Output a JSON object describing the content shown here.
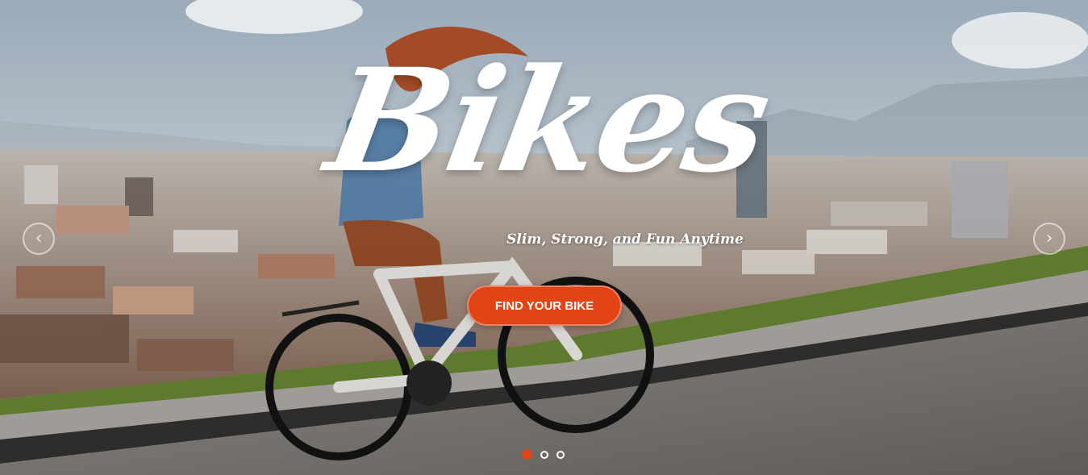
{
  "hero": {
    "title": "Bikes",
    "subtitle": "Slim, Strong, and Fun Anytime",
    "cta_label": "FIND YOUR BIKE"
  },
  "carousel": {
    "prev_icon": "chevron-left-icon",
    "next_icon": "chevron-right-icon",
    "prev_glyph": "‹",
    "next_glyph": "›",
    "slide_count": 3,
    "active_slide": 1
  },
  "colors": {
    "accent": "#e24416",
    "sky": "#b9c6d1",
    "road": "#7b7772"
  }
}
